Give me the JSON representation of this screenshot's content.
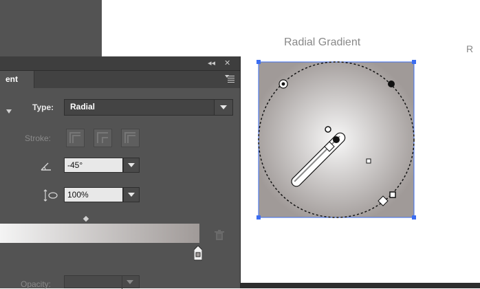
{
  "canvas": {
    "title": "Radial Gradient",
    "next_title_fragment": "R"
  },
  "panel": {
    "tab_label": "ent",
    "type_label": "Type:",
    "type_value": "Radial",
    "stroke_label": "Stroke:",
    "angle_value": "-45°",
    "aspect_value": "100%",
    "opacity_label": "Opacity:"
  },
  "gradient": {
    "start_color": "#f4f4f4",
    "end_color": "#a09a98"
  },
  "colors": {
    "panel": "#535353",
    "selection": "#3b6df2"
  },
  "icons": {
    "collapse": "double-chevron-left-icon",
    "close": "close-icon",
    "menu": "panel-menu-icon",
    "angle": "angle-icon",
    "aspect": "aspect-ratio-icon",
    "trash": "trash-icon"
  }
}
